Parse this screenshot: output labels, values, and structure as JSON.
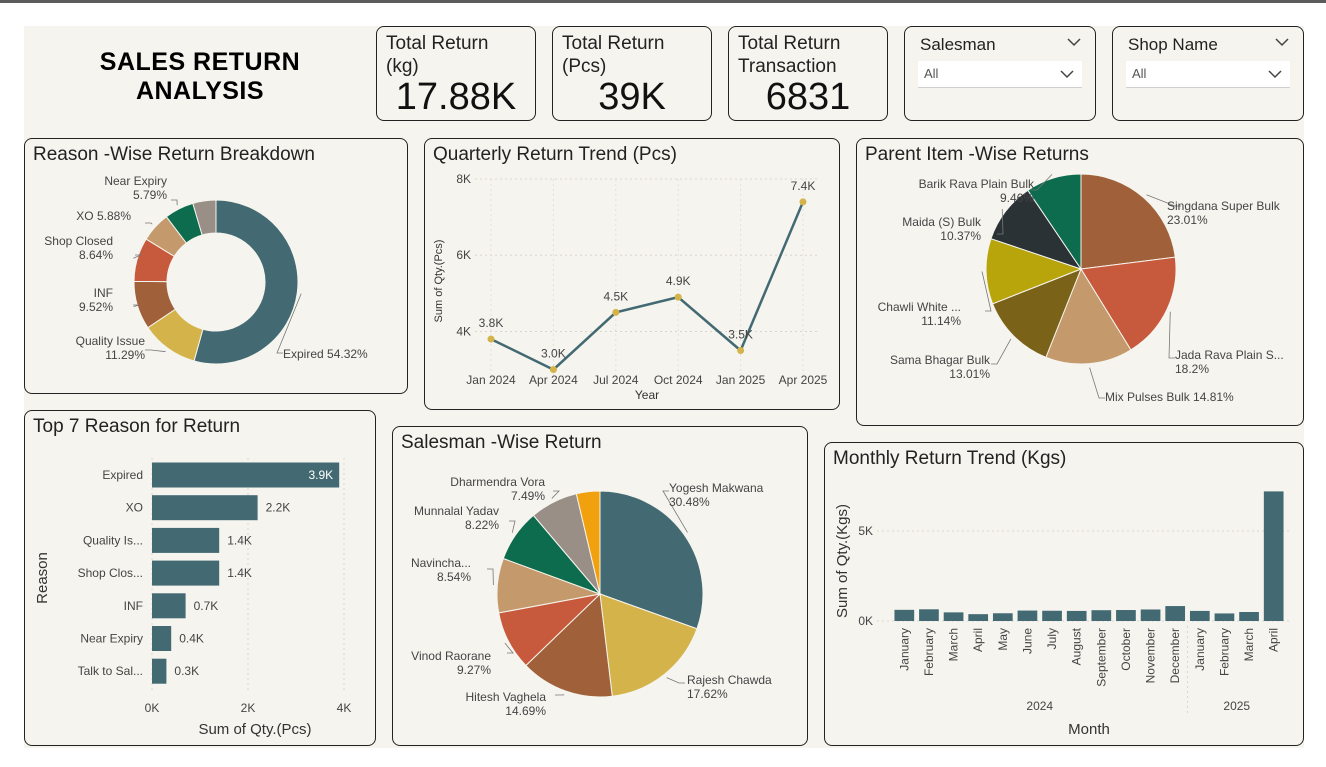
{
  "title_line1": "SALES RETURN",
  "title_line2": "ANALYSIS",
  "kpis": [
    {
      "label": "Total Return (kg)",
      "value": "17.88K"
    },
    {
      "label": "Total Return (Pcs)",
      "value": "39K"
    },
    {
      "label": "Total Return Transaction",
      "value": "6831"
    }
  ],
  "slicers": [
    {
      "label": "Salesman",
      "value": "All"
    },
    {
      "label": "Shop Name",
      "value": "All"
    }
  ],
  "colors": {
    "teal": "#436a73",
    "gold": "#d4b44a",
    "brown": "#a0613a",
    "red": "#c75a3d",
    "green": "#0d6b4e",
    "tan": "#c49a6c",
    "gray": "#9a8f86",
    "orange": "#f2a10e",
    "charcoal": "#2b3236",
    "olive": "#b8a50c",
    "darkolive": "#7a6218",
    "marker": "#d4b44a"
  },
  "chart_data": [
    {
      "type": "pie",
      "variant": "donut",
      "title": "Reason -Wise Return Breakdown",
      "slices": [
        {
          "label": "Expired",
          "pct": "54.32%",
          "value": 54.32,
          "color": "#436a73"
        },
        {
          "label": "Quality Issue",
          "pct": "11.29%",
          "value": 11.29,
          "color": "#d4b44a"
        },
        {
          "label": "INF",
          "pct": "9.52%",
          "value": 9.52,
          "color": "#a0613a"
        },
        {
          "label": "Shop Closed",
          "pct": "8.64%",
          "value": 8.64,
          "color": "#c75a3d"
        },
        {
          "label": "XO",
          "pct": "5.88%",
          "value": 5.88,
          "color": "#c49a6c"
        },
        {
          "label": "Near Expiry",
          "pct": "5.79%",
          "value": 5.79,
          "color": "#0d6b4e"
        },
        {
          "label": "",
          "pct": "",
          "value": 4.56,
          "color": "#9a8f86"
        }
      ]
    },
    {
      "type": "line",
      "title": "Quarterly Return Trend (Pcs)",
      "xlabel": "Year",
      "ylabel": "Sum of Qty.(Pcs)",
      "categories": [
        "Jan 2024",
        "Apr 2024",
        "Jul 2024",
        "Oct 2024",
        "Jan 2025",
        "Apr 2025"
      ],
      "x_index": [
        0,
        1,
        2,
        3,
        4,
        5
      ],
      "values": [
        3800,
        3000,
        4500,
        4900,
        3500,
        7400
      ],
      "value_labels": [
        "3.8K",
        "3.0K",
        "4.5K",
        "4.9K",
        "3.5K",
        "7.4K"
      ],
      "yticks": [
        {
          "v": 4000,
          "t": "4K"
        },
        {
          "v": 6000,
          "t": "6K"
        },
        {
          "v": 8000,
          "t": "8K"
        }
      ],
      "ylim": [
        2700,
        8000
      ]
    },
    {
      "type": "pie",
      "title": "Parent Item -Wise Returns",
      "slices": [
        {
          "label": "Singdana Super Bulk",
          "pct": "23.01%",
          "value": 23.01,
          "color": "#a0613a"
        },
        {
          "label": "Jada Rava Plain S...",
          "pct": "18.2%",
          "value": 18.2,
          "color": "#c75a3d"
        },
        {
          "label": "Mix Pulses Bulk",
          "pct": "14.81%",
          "value": 14.81,
          "color": "#c49a6c"
        },
        {
          "label": "Sama Bhagar Bulk",
          "pct": "13.01%",
          "value": 13.01,
          "color": "#7a6218"
        },
        {
          "label": "Chawli White ...",
          "pct": "11.14%",
          "value": 11.14,
          "color": "#b8a50c"
        },
        {
          "label": "Maida (S) Bulk",
          "pct": "10.37%",
          "value": 10.37,
          "color": "#2b3236"
        },
        {
          "label": "Barik Rava Plain Bulk",
          "pct": "9.46%",
          "value": 9.46,
          "color": "#0d6b4e"
        }
      ]
    },
    {
      "type": "bar",
      "orientation": "horizontal",
      "title": "Top 7 Reason for Return",
      "xlabel": "Sum of Qty.(Pcs)",
      "ylabel": "Reason",
      "categories": [
        "Expired",
        "XO",
        "Quality Is...",
        "Shop Clos...",
        "INF",
        "Near Expiry",
        "Talk to Sal..."
      ],
      "values": [
        3900,
        2200,
        1400,
        1400,
        700,
        400,
        300
      ],
      "value_labels": [
        "3.9K",
        "2.2K",
        "1.4K",
        "1.4K",
        "0.7K",
        "0.4K",
        "0.3K"
      ],
      "xticks": [
        {
          "v": 0,
          "t": "0K"
        },
        {
          "v": 2000,
          "t": "2K"
        },
        {
          "v": 4000,
          "t": "4K"
        }
      ],
      "xlim": [
        0,
        4000
      ]
    },
    {
      "type": "pie",
      "title": "Salesman -Wise Return",
      "slices": [
        {
          "label": "Yogesh Makwana",
          "pct": "30.48%",
          "value": 30.48,
          "color": "#436a73"
        },
        {
          "label": "Rajesh Chawda",
          "pct": "17.62%",
          "value": 17.62,
          "color": "#d4b44a"
        },
        {
          "label": "Hitesh Vaghela",
          "pct": "14.69%",
          "value": 14.69,
          "color": "#a0613a"
        },
        {
          "label": "Vinod Raorane",
          "pct": "9.27%",
          "value": 9.27,
          "color": "#c75a3d"
        },
        {
          "label": "Navincha...",
          "pct": "8.54%",
          "value": 8.54,
          "color": "#c49a6c"
        },
        {
          "label": "Munnalal Yadav",
          "pct": "8.22%",
          "value": 8.22,
          "color": "#0d6b4e"
        },
        {
          "label": "Dharmendra Vora",
          "pct": "7.49%",
          "value": 7.49,
          "color": "#9a8f86"
        },
        {
          "label": "",
          "pct": "",
          "value": 3.69,
          "color": "#f2a10e"
        }
      ]
    },
    {
      "type": "bar",
      "title": "Monthly Return Trend (Kgs)",
      "xlabel": "Month",
      "ylabel": "Sum of Qty.(Kgs)",
      "categories": [
        "January",
        "February",
        "March",
        "April",
        "May",
        "June",
        "July",
        "August",
        "September",
        "October",
        "November",
        "December",
        "January",
        "February",
        "March",
        "April"
      ],
      "years": [
        {
          "label": "2024",
          "from": 0,
          "to": 11
        },
        {
          "label": "2025",
          "from": 12,
          "to": 15
        }
      ],
      "values": [
        620,
        650,
        480,
        380,
        430,
        580,
        570,
        560,
        600,
        610,
        640,
        830,
        560,
        420,
        500,
        7200
      ],
      "yticks": [
        {
          "v": 0,
          "t": "0K"
        },
        {
          "v": 5000,
          "t": "5K"
        }
      ],
      "ylim": [
        0,
        7500
      ]
    }
  ]
}
